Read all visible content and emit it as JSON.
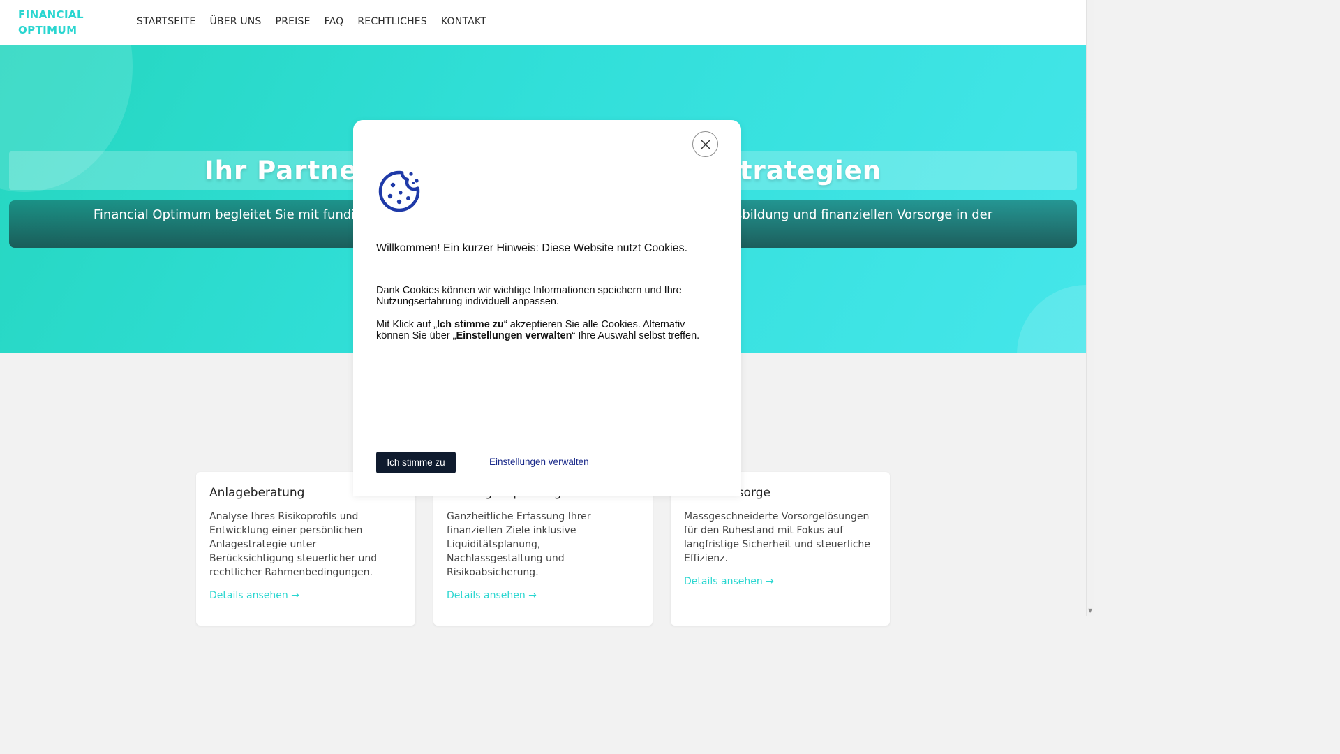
{
  "header": {
    "brand_line1": "FINANCIAL",
    "brand_line2": "OPTIMUM",
    "nav": [
      {
        "label": "STARTSEITE"
      },
      {
        "label": "ÜBER UNS"
      },
      {
        "label": "PREISE"
      },
      {
        "label": "FAQ"
      },
      {
        "label": "RECHTLICHES"
      },
      {
        "label": "KONTAKT"
      }
    ]
  },
  "hero": {
    "title": "Ihr Partner für nachhaltige Finanzstrategien",
    "subtitle": "Financial Optimum begleitet Sie mit fundierter Expertise und individueller Beratung bei der Vermögensbildung und finanziellen Vorsorge in der"
  },
  "cards": [
    {
      "title": "Anlageberatung",
      "text": "Analyse Ihres Risikoprofils und Entwicklung einer persönlichen Anlagestrategie unter Berücksichtigung steuerlicher und rechtlicher Rahmenbedingungen.",
      "link": "Details ansehen →"
    },
    {
      "title": "Vermögensplanung",
      "text": "Ganzheitliche Erfassung Ihrer finanziellen Ziele inklusive Liquiditätsplanung, Nachlassgestaltung und Risikoabsicherung.",
      "link": "Details ansehen →"
    },
    {
      "title": "Altersvorsorge",
      "text": "Massgeschneiderte Vorsorgelösungen für den Ruhestand mit Fokus auf langfristige Sicherheit und steuerliche Effizienz.",
      "link": "Details ansehen →"
    }
  ],
  "cookie": {
    "heading": "Willkommen! Ein kurzer Hinweis: Diese Website nutzt Cookies.",
    "text1": "Dank Cookies können wir wichtige Informationen speichern und Ihre Nutzungserfahrung individuell anpassen.",
    "text2_a": "Mit Klick auf „",
    "text2_b": "Ich stimme zu",
    "text2_c": "“ akzeptieren Sie alle Cookies. Alternativ können Sie über „",
    "text2_d": "Einstellungen verwalten",
    "text2_e": "“ Ihre Auswahl selbst treffen.",
    "accept_label": "Ich stimme zu",
    "settings_label": "Einstellungen verwalten",
    "icon_color": "#1f3aa8"
  },
  "colors": {
    "accent": "#2ad6d0",
    "dark_button": "#0f1b2e"
  }
}
